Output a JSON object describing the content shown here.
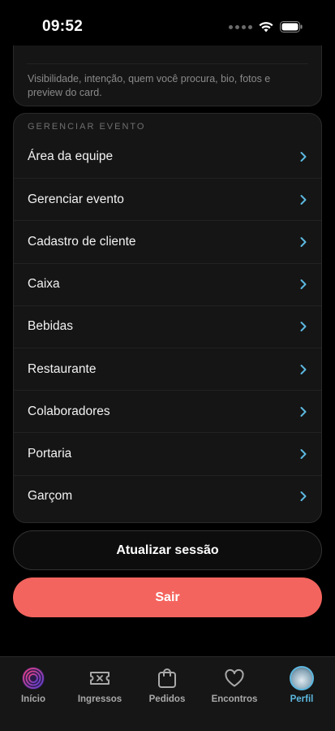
{
  "status_bar": {
    "time": "09:52"
  },
  "profile_card": {
    "description": "Visibilidade, intenção, quem você procura, bio, fotos e preview do card."
  },
  "manage_section": {
    "title": "GERENCIAR EVENTO",
    "items": [
      {
        "label": "Área da equipe"
      },
      {
        "label": "Gerenciar evento"
      },
      {
        "label": "Cadastro de cliente"
      },
      {
        "label": "Caixa"
      },
      {
        "label": "Bebidas"
      },
      {
        "label": "Restaurante"
      },
      {
        "label": "Colaboradores"
      },
      {
        "label": "Portaria"
      },
      {
        "label": "Garçom"
      }
    ]
  },
  "buttons": {
    "refresh_label": "Atualizar sessão",
    "logout_label": "Sair"
  },
  "tabbar": {
    "items": [
      {
        "label": "Início",
        "icon": "app-logo-icon"
      },
      {
        "label": "Ingressos",
        "icon": "ticket-icon"
      },
      {
        "label": "Pedidos",
        "icon": "shopping-bag-icon"
      },
      {
        "label": "Encontros",
        "icon": "heart-icon"
      },
      {
        "label": "Perfil",
        "icon": "avatar"
      }
    ],
    "active": "Perfil"
  },
  "colors": {
    "accent": "#5cb8e0",
    "logout": "#f4645e",
    "background": "#000000",
    "card": "#151515"
  }
}
